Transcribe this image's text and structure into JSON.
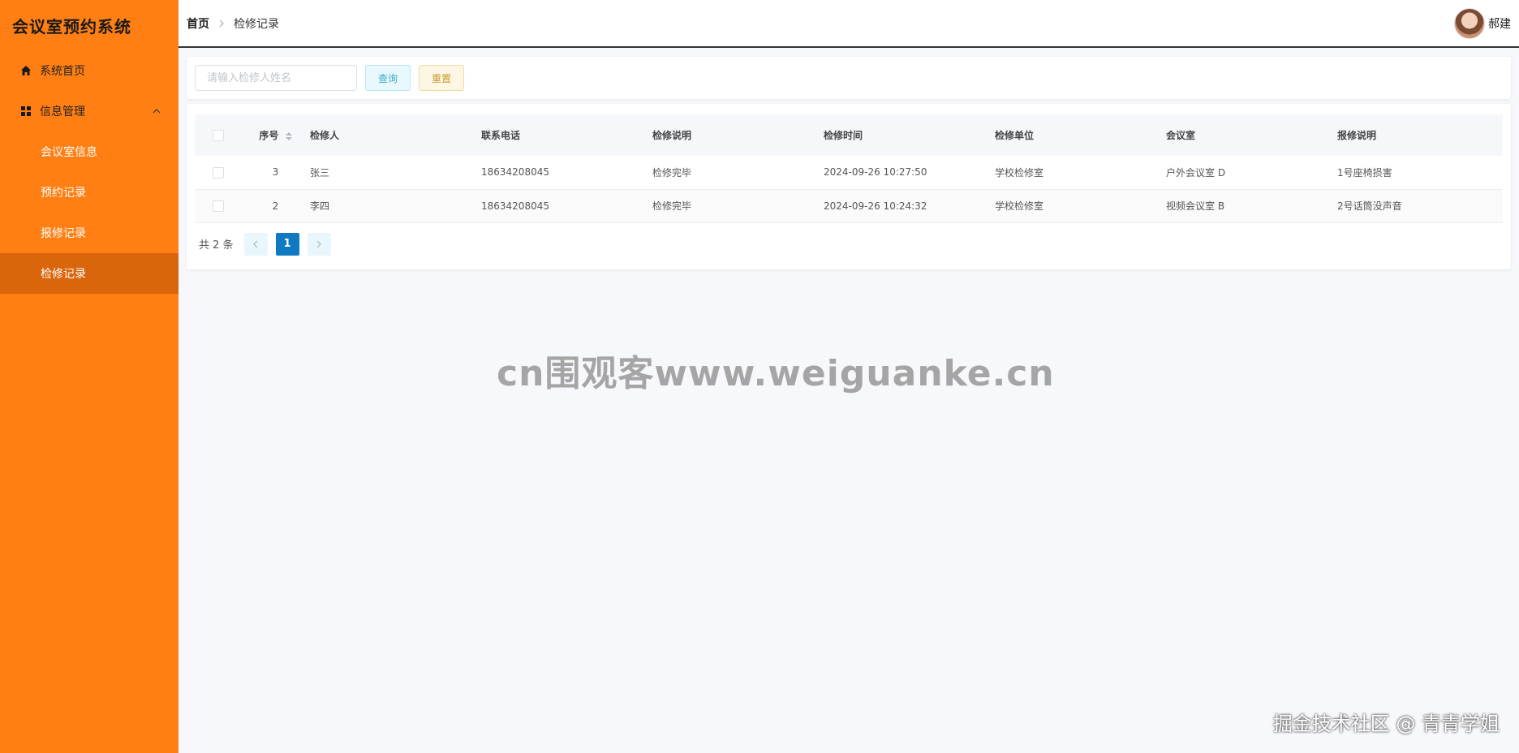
{
  "app": {
    "title": "会议室预约系统"
  },
  "sidebar": {
    "items": [
      {
        "label": "系统首页",
        "icon": "home-icon"
      },
      {
        "label": "信息管理",
        "icon": "grid-icon",
        "expanded": true,
        "children": [
          {
            "label": "会议室信息"
          },
          {
            "label": "预约记录"
          },
          {
            "label": "报修记录"
          },
          {
            "label": "检修记录",
            "active": true
          }
        ]
      }
    ]
  },
  "header": {
    "breadcrumb": {
      "home": "首页",
      "current": "检修记录"
    },
    "user": {
      "name": "郝建"
    }
  },
  "search": {
    "placeholder": "请输入检修人姓名",
    "value": "",
    "query_label": "查询",
    "reset_label": "重置"
  },
  "table": {
    "columns": [
      "序号",
      "检修人",
      "联系电话",
      "检修说明",
      "检修时间",
      "检修单位",
      "会议室",
      "报修说明"
    ],
    "rows": [
      {
        "seq": "3",
        "repairer": "张三",
        "phone": "18634208045",
        "note": "检修完毕",
        "time": "2024-09-26 10:27:50",
        "unit": "学校检修室",
        "room": "户外会议室 D",
        "report": "1号座椅损害"
      },
      {
        "seq": "2",
        "repairer": "李四",
        "phone": "18634208045",
        "note": "检修完毕",
        "time": "2024-09-26 10:24:32",
        "unit": "学校检修室",
        "room": "视频会议室 B",
        "report": "2号话筒没声音"
      }
    ]
  },
  "pagination": {
    "total_text": "共 2 条",
    "current_page": "1"
  },
  "watermarks": {
    "center": "cn围观客www.weiguanke.cn",
    "bottom": "掘金技术社区 @ 青青学姐"
  },
  "colors": {
    "sidebar": "#ff7f14",
    "sidebar_active": "#d9650c",
    "page_active": "#0f7ac2"
  }
}
